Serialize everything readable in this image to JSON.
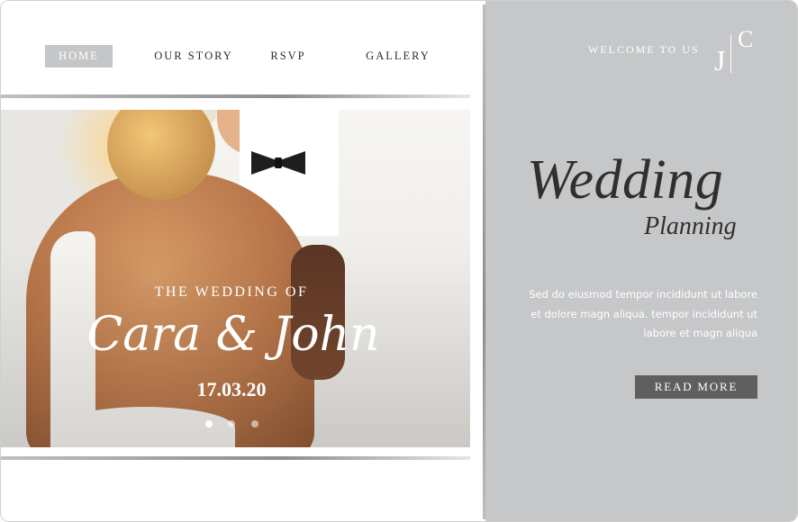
{
  "nav": {
    "items": [
      {
        "label": "HOME",
        "active": true
      },
      {
        "label": "OUR STORY",
        "active": false
      },
      {
        "label": "RSVP",
        "active": false
      },
      {
        "label": "GALLERY",
        "active": false
      }
    ]
  },
  "hero": {
    "subtitle": "THE WEDDING OF",
    "names": "Cara & John",
    "date": "17.03.20",
    "slides": {
      "count": 3,
      "active_index": 0
    }
  },
  "sidebar": {
    "welcome": "WELCOME TO US",
    "monogram": {
      "left": "J",
      "right": "C"
    },
    "title": "Wedding",
    "subtitle": "Planning",
    "body_lines": [
      "Sed do eiusmod tempor incididunt ut labore",
      "et dolore magn aliqua. tempor incididunt ut",
      "labore et  magn aliqua"
    ],
    "cta_label": "READ MORE"
  },
  "colors": {
    "accent_gray": "#c6c7c9",
    "button_dark": "#5f5f5f",
    "nav_active_bg": "#c5c6c8",
    "title_text": "#2f2f2f"
  }
}
